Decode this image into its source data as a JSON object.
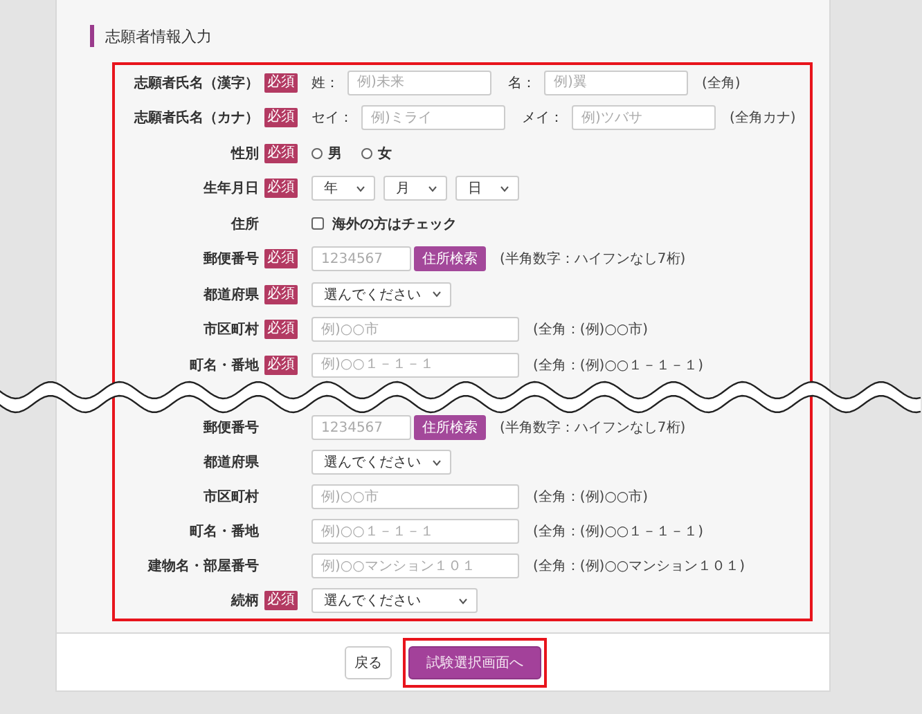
{
  "section_title": "志願者情報入力",
  "rows_top": [
    {
      "kind": "name",
      "label": "志願者氏名（漢字）",
      "badge": "必須",
      "parts": [
        {
          "prefix": "姓：",
          "placeholder": "例)未来"
        },
        {
          "prefix": "名：",
          "placeholder": "例)翼"
        }
      ],
      "hint": "(全角)"
    },
    {
      "kind": "name",
      "label": "志願者氏名（カナ）",
      "badge": "必須",
      "parts": [
        {
          "prefix": "セイ：",
          "placeholder": "例)ミライ"
        },
        {
          "prefix": "メイ：",
          "placeholder": "例)ツバサ"
        }
      ],
      "hint": "(全角カナ)"
    },
    {
      "kind": "radio",
      "label": "性別",
      "badge": "必須",
      "options": [
        {
          "label": "男",
          "selected": false
        },
        {
          "label": "女",
          "selected": false
        }
      ]
    },
    {
      "kind": "date",
      "label": "生年月日",
      "badge": "必須",
      "selects": [
        "年",
        "月",
        "日"
      ]
    },
    {
      "kind": "checkbox",
      "label": "住所",
      "text": "海外の方はチェック",
      "checked": false
    },
    {
      "kind": "postal",
      "label": "郵便番号",
      "badge": "必須",
      "placeholder": "1234567",
      "button": "住所検索",
      "hint": "(半角数字：ハイフンなし7桁)"
    },
    {
      "kind": "select",
      "label": "都道府県",
      "badge": "必須",
      "value": "選んでください"
    },
    {
      "kind": "text",
      "label": "市区町村",
      "badge": "必須",
      "placeholder": "例)○○市",
      "hint": "(全角：(例)○○市)"
    },
    {
      "kind": "text",
      "label": "町名・番地",
      "badge": "必須",
      "placeholder": "例)○○１－１－１",
      "hint": "(全角：(例)○○１－１－１)"
    }
  ],
  "rows_bottom": [
    {
      "kind": "postal",
      "label": "郵便番号",
      "placeholder": "1234567",
      "button": "住所検索",
      "hint": "(半角数字：ハイフンなし7桁)"
    },
    {
      "kind": "select",
      "label": "都道府県",
      "value": "選んでください"
    },
    {
      "kind": "text",
      "label": "市区町村",
      "placeholder": "例)○○市",
      "hint": "(全角：(例)○○市)"
    },
    {
      "kind": "text",
      "label": "町名・番地",
      "placeholder": "例)○○１－１－１",
      "hint": "(全角：(例)○○１－１－１)"
    },
    {
      "kind": "text",
      "label": "建物名・部屋番号",
      "placeholder": "例)○○マンション１０１",
      "hint": "(全角：(例)○○マンション１０１)"
    },
    {
      "kind": "wide_select",
      "label": "続柄",
      "badge": "必須",
      "value": "選んでください"
    }
  ],
  "buttons": [
    {
      "label": "戻る",
      "kind": "secondary",
      "highlighted": false
    },
    {
      "label": "試験選択画面へ",
      "kind": "primary",
      "highlighted": true
    }
  ]
}
